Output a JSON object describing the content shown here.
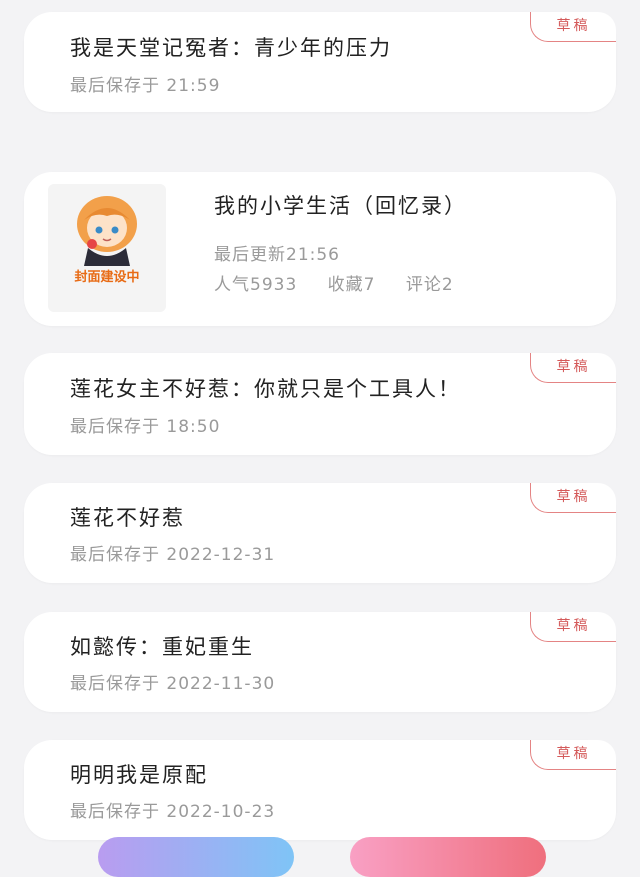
{
  "badge_label": "草稿",
  "cards": [
    {
      "title": "我是天堂记冤者：青少年的压力",
      "meta": "最后保存于 21:59"
    },
    {
      "title": "莲花女主不好惹：你就只是个工具人！",
      "meta": "最后保存于 18:50"
    },
    {
      "title": "莲花不好惹",
      "meta": "最后保存于 2022-12-31"
    },
    {
      "title": "如懿传：重妃重生",
      "meta": "最后保存于 2022-11-30"
    },
    {
      "title": "明明我是原配",
      "meta": "最后保存于 2022-10-23"
    }
  ],
  "published": {
    "cover_label": "封面建设中",
    "title": "我的小学生活（回忆录）",
    "updated": "最后更新21:56",
    "popularity": "人气5933",
    "favorites": "收藏7",
    "comments": "评论2"
  },
  "colors": {
    "badge": "#d45a5a",
    "cover_label": "#e86b15",
    "button_left": "#8fb5f5",
    "button_right": "#f07b9a"
  }
}
